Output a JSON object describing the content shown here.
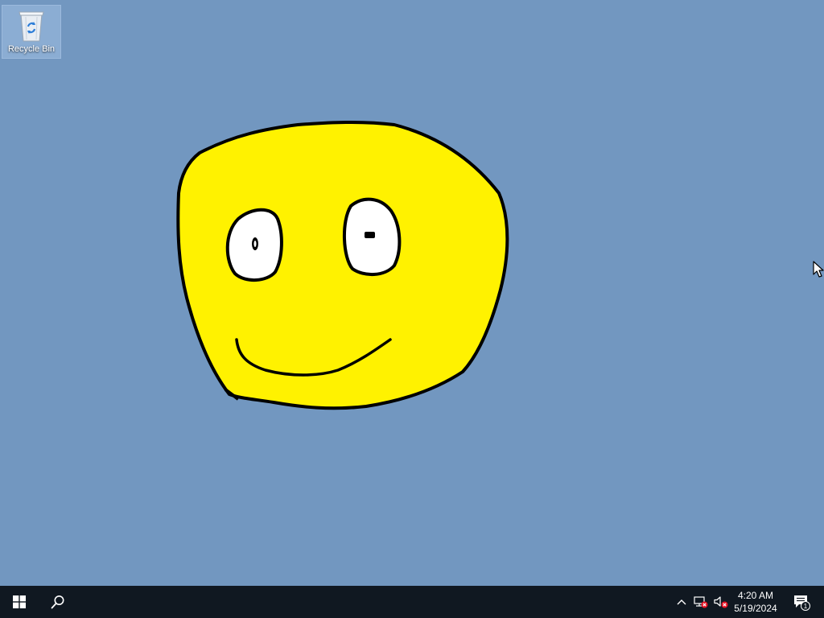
{
  "desktop": {
    "background_color": "#7297c0",
    "icons": [
      {
        "label": "Recycle Bin",
        "icon": "recycle-bin-icon"
      }
    ]
  },
  "drawing": {
    "subject": "smiley-face-drawing",
    "fill_color": "#fff200",
    "outline_color": "#000000",
    "eye_color": "#ffffff"
  },
  "taskbar": {
    "background_color": "#101821",
    "start_icon": "windows-logo-icon",
    "search_icon": "search-icon",
    "tray": {
      "chevron_icon": "chevron-up-icon",
      "network_icon": "network-disconnected-icon",
      "volume_icon": "volume-muted-icon"
    },
    "clock": {
      "time": "4:20 AM",
      "date": "5/19/2024"
    },
    "notifications": {
      "icon": "action-center-icon",
      "count": "1"
    }
  }
}
